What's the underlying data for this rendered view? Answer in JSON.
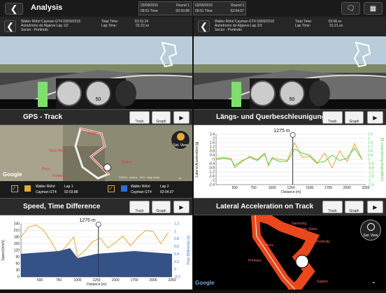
{
  "header": {
    "title": "Analysis"
  },
  "sessions": [
    {
      "date": "03/09/2015",
      "round": "Round 1",
      "time": "09:51 Time",
      "laptime": "02:03.88",
      "color": "#e8a838"
    },
    {
      "date": "03/09/2015",
      "round": "Round 3",
      "time": "09:51 Time",
      "laptime": "02:04.07",
      "color": "#2b6fd6"
    }
  ],
  "video_left": {
    "line1": "Walter Röhrl  Cayman GT4  03/09/2015",
    "line2": "Autodromo do Algarve  Lap 1/2",
    "line3": "Sector - Portimão",
    "total_label": "Total Time:",
    "total_val": "03:10.24",
    "lap_label": "Lap Time:",
    "lap_val": "01:22.xx",
    "speed": "50"
  },
  "video_right": {
    "line1": "Walter Röhrl  Cayman GT4  03/09/2015",
    "line2": "Autodromo do Algarve  Lap 2/3",
    "line3": "Sector - Portimão",
    "total_label": "Total Time:",
    "total_val": "03:49.xx",
    "lap_label": "Lap Time:",
    "lap_val": "01:21.xx",
    "speed": "50"
  },
  "panels": {
    "gps": {
      "title": "GPS - Track",
      "btn_track": "Track",
      "btn_graph": "Graph",
      "sat": "Sat. View",
      "google": "Google",
      "copyright": "©2015 · Airbus · IKG · Map Data",
      "labels": [
        "Ascari",
        "Torre Hora",
        "Sagres",
        "Poço",
        "Portimão"
      ]
    },
    "lat": {
      "title": "Längs- und Querbeschleunigung",
      "btn_track": "Track",
      "btn_graph": "Graph",
      "marker": "1275 m",
      "ylabel_left": "Lateral Acceleration [g]",
      "ylabel_right": "Longitudinal Acceleration [g]",
      "xlabel": "Distance [m]"
    },
    "speed": {
      "title": "Speed, Time Difference",
      "btn_track": "Track",
      "btn_graph": "Graph",
      "marker": "1275 m",
      "ylabel_left": "Speed [km/h]",
      "ylabel_right": "Time Difference [s]",
      "xlabel": "Distance [m]"
    },
    "lattrack": {
      "title": "Lateral Acceleration on Track",
      "btn_track": "Track",
      "btn_graph": "Graph",
      "sat": "Sat. View",
      "google": "Google",
      "labels": [
        "Samsung",
        "Craig Jones",
        "Portimão",
        "Torre Hora",
        "Primeira",
        "Sagres"
      ]
    }
  },
  "legend": [
    {
      "name": "Walter Röhrl",
      "car": "Cayman GT4",
      "lap": "Lap 1",
      "time": "02:03.88",
      "color": "#e8a838"
    },
    {
      "name": "Walter Röhrl",
      "car": "Cayman GT4",
      "lap": "Lap 2",
      "time": "02:04.07",
      "color": "#2b6fd6"
    }
  ],
  "chart_data": [
    {
      "type": "line",
      "title": "Längs- und Querbeschleunigung",
      "xlabel": "Distance [m]",
      "ylabel": "Lateral Acceleration [g]",
      "xlim": [
        250,
        2250
      ],
      "ylim": [
        -2.4,
        2.4
      ],
      "x_ticks": [
        500,
        750,
        1000,
        1250,
        1500,
        1750,
        2000,
        2250
      ],
      "y_ticks": [
        2.4,
        2.0,
        1.6,
        1.2,
        0.8,
        0.4,
        0.0,
        -0.4,
        -0.8,
        -1.2,
        -1.6,
        -2.0,
        -2.4
      ],
      "series": [
        {
          "name": "Lap 1",
          "color": "#e8a838",
          "x": [
            250,
            350,
            450,
            500,
            600,
            700,
            800,
            900,
            950,
            1000,
            1100,
            1200,
            1300,
            1400,
            1500,
            1600,
            1700,
            1800,
            1900,
            2000,
            2100,
            2200
          ],
          "values": [
            0.1,
            0.2,
            0.1,
            -0.8,
            -0.2,
            0.3,
            0.0,
            0.6,
            -0.6,
            0.2,
            0.0,
            -0.1,
            1.6,
            0.2,
            0.3,
            -0.4,
            0.6,
            -0.8,
            0.8,
            -0.2,
            1.5,
            0.0
          ]
        },
        {
          "name": "Lap 2",
          "color": "#4bcf50",
          "x": [
            250,
            350,
            450,
            500,
            600,
            700,
            800,
            900,
            950,
            1000,
            1100,
            1200,
            1300,
            1400,
            1500,
            1600,
            1700,
            1800,
            1900,
            2000,
            2100,
            2200
          ],
          "values": [
            0.0,
            0.1,
            0.0,
            -0.6,
            -0.1,
            0.2,
            -0.1,
            0.5,
            -0.5,
            0.1,
            -0.2,
            -0.2,
            1.0,
            0.6,
            0.4,
            -0.3,
            -0.2,
            0.4,
            -0.1,
            0.1,
            1.1,
            0.0
          ]
        }
      ]
    },
    {
      "type": "line",
      "title": "Speed, Time Difference",
      "xlabel": "Distance [m]",
      "ylabel": "Speed [km/h]",
      "xlim": [
        250,
        2250
      ],
      "ylim": [
        0,
        240
      ],
      "x_ticks": [
        500,
        750,
        1000,
        1250,
        1500,
        1750,
        2000,
        2250
      ],
      "y_ticks": [
        240,
        210,
        180,
        150,
        120,
        90,
        60,
        30,
        0
      ],
      "y2_ticks": [
        1.2,
        1.0,
        0.8,
        0.6,
        0.4,
        0.2,
        0.0,
        -0.2
      ],
      "series": [
        {
          "name": "Speed",
          "color": "#e8a838",
          "x": [
            250,
            350,
            450,
            550,
            650,
            750,
            850,
            950,
            1000,
            1100,
            1200,
            1300,
            1400,
            1500,
            1600,
            1700,
            1800,
            1900,
            2000,
            2100,
            2200
          ],
          "values": [
            180,
            225,
            235,
            210,
            160,
            100,
            140,
            180,
            90,
            120,
            160,
            175,
            130,
            155,
            185,
            140,
            180,
            210,
            205,
            150,
            200
          ]
        },
        {
          "name": "Time Difference",
          "color": "#2b6fd6",
          "x": [
            250,
            500,
            750,
            900,
            1000,
            1250,
            1500,
            1750,
            2000,
            2250
          ],
          "values": [
            0.0,
            0.05,
            0.1,
            0.2,
            -0.15,
            0.0,
            0.05,
            0.1,
            0.05,
            0.0
          ]
        }
      ]
    }
  ]
}
